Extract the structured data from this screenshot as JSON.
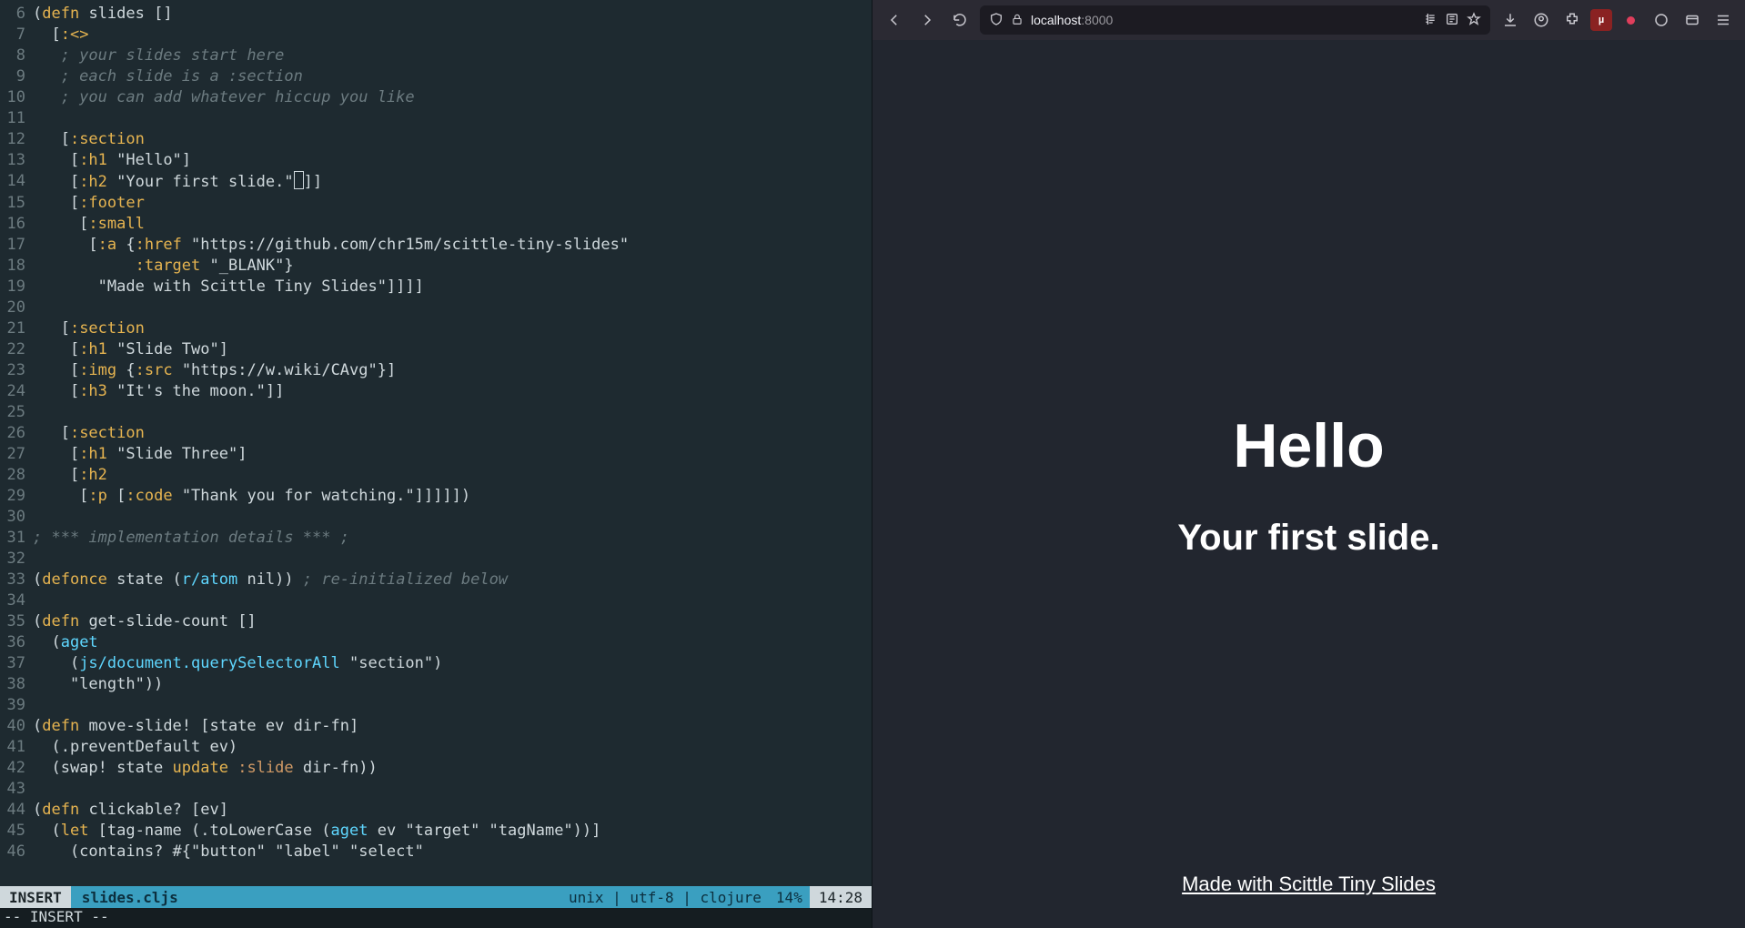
{
  "editor": {
    "filename": "slides.cljs",
    "statusbar": {
      "mode": "INSERT",
      "encoding_line": "unix | utf-8 | clojure",
      "percent": "14%",
      "position": "14:28"
    },
    "echo": "-- INSERT --",
    "lines": [
      {
        "n": 6,
        "text": "(defn slides []"
      },
      {
        "n": 7,
        "text": "  [:<>"
      },
      {
        "n": 8,
        "text": "   ; your slides start here"
      },
      {
        "n": 9,
        "text": "   ; each slide is a :section"
      },
      {
        "n": 10,
        "text": "   ; you can add whatever hiccup you like"
      },
      {
        "n": 11,
        "text": ""
      },
      {
        "n": 12,
        "text": "   [:section"
      },
      {
        "n": 13,
        "text": "    [:h1 \"Hello\"]"
      },
      {
        "n": 14,
        "text": "    [:h2 \"Your first slide.\"]]"
      },
      {
        "n": 15,
        "text": "    [:footer"
      },
      {
        "n": 16,
        "text": "     [:small"
      },
      {
        "n": 17,
        "text": "      [:a {:href \"https://github.com/chr15m/scittle-tiny-slides\""
      },
      {
        "n": 18,
        "text": "           :target \"_BLANK\"}"
      },
      {
        "n": 19,
        "text": "       \"Made with Scittle Tiny Slides\"]]]]"
      },
      {
        "n": 20,
        "text": ""
      },
      {
        "n": 21,
        "text": "   [:section"
      },
      {
        "n": 22,
        "text": "    [:h1 \"Slide Two\"]"
      },
      {
        "n": 23,
        "text": "    [:img {:src \"https://w.wiki/CAvg\"}]"
      },
      {
        "n": 24,
        "text": "    [:h3 \"It's the moon.\"]]"
      },
      {
        "n": 25,
        "text": ""
      },
      {
        "n": 26,
        "text": "   [:section"
      },
      {
        "n": 27,
        "text": "    [:h1 \"Slide Three\"]"
      },
      {
        "n": 28,
        "text": "    [:h2"
      },
      {
        "n": 29,
        "text": "     [:p [:code \"Thank you for watching.\"]]]]])"
      },
      {
        "n": 30,
        "text": ""
      },
      {
        "n": 31,
        "text": "; *** implementation details *** ;"
      },
      {
        "n": 32,
        "text": ""
      },
      {
        "n": 33,
        "text": "(defonce state (r/atom nil)) ; re-initialized below"
      },
      {
        "n": 34,
        "text": ""
      },
      {
        "n": 35,
        "text": "(defn get-slide-count []"
      },
      {
        "n": 36,
        "text": "  (aget"
      },
      {
        "n": 37,
        "text": "    (js/document.querySelectorAll \"section\")"
      },
      {
        "n": 38,
        "text": "    \"length\"))"
      },
      {
        "n": 39,
        "text": ""
      },
      {
        "n": 40,
        "text": "(defn move-slide! [state ev dir-fn]"
      },
      {
        "n": 41,
        "text": "  (.preventDefault ev)"
      },
      {
        "n": 42,
        "text": "  (swap! state update :slide dir-fn))"
      },
      {
        "n": 43,
        "text": ""
      },
      {
        "n": 44,
        "text": "(defn clickable? [ev]"
      },
      {
        "n": 45,
        "text": "  (let [tag-name (.toLowerCase (aget ev \"target\" \"tagName\"))]"
      },
      {
        "n": 46,
        "text": "    (contains? #{\"button\" \"label\" \"select\""
      }
    ]
  },
  "browser": {
    "url_host": "localhost",
    "url_port": ":8000",
    "slide": {
      "h1": "Hello",
      "h2": "Your first slide.",
      "footer_link_text": "Made with Scittle Tiny Slides"
    }
  }
}
